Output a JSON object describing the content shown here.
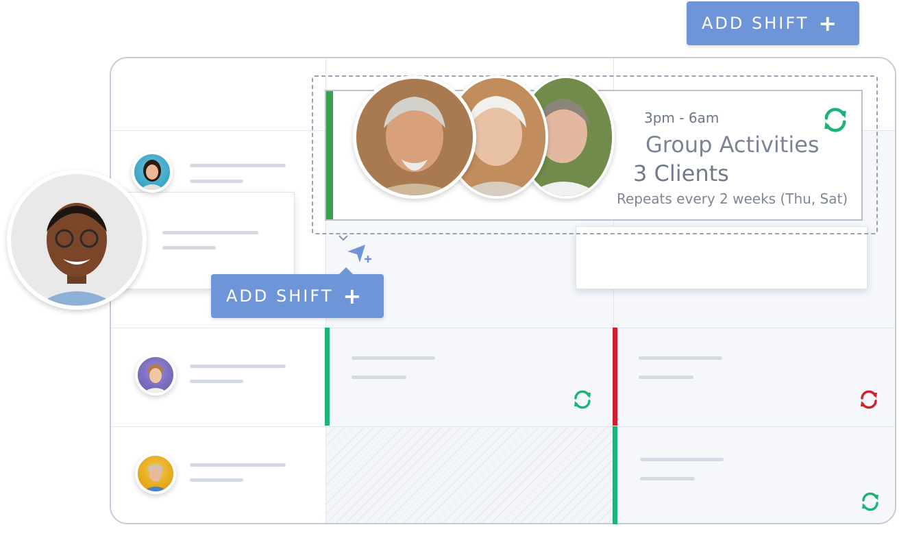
{
  "buttons": {
    "add_shift_top": "ADD SHIFT",
    "add_shift_floating": "ADD SHIFT",
    "plus": "+"
  },
  "shift_card": {
    "time": "3pm - 6am",
    "title": "Group Activities",
    "clients": "3 Clients",
    "repeat": "Repeats every 2 weeks (Thu, Sat)"
  },
  "colors": {
    "accent_blue": "#6f95d9",
    "green": "#1db378",
    "red": "#d1202f",
    "card_green": "#37a14e"
  },
  "icons": [
    "sync-icon",
    "send-plus-icon",
    "plus-icon",
    "chevron-down-icon"
  ]
}
